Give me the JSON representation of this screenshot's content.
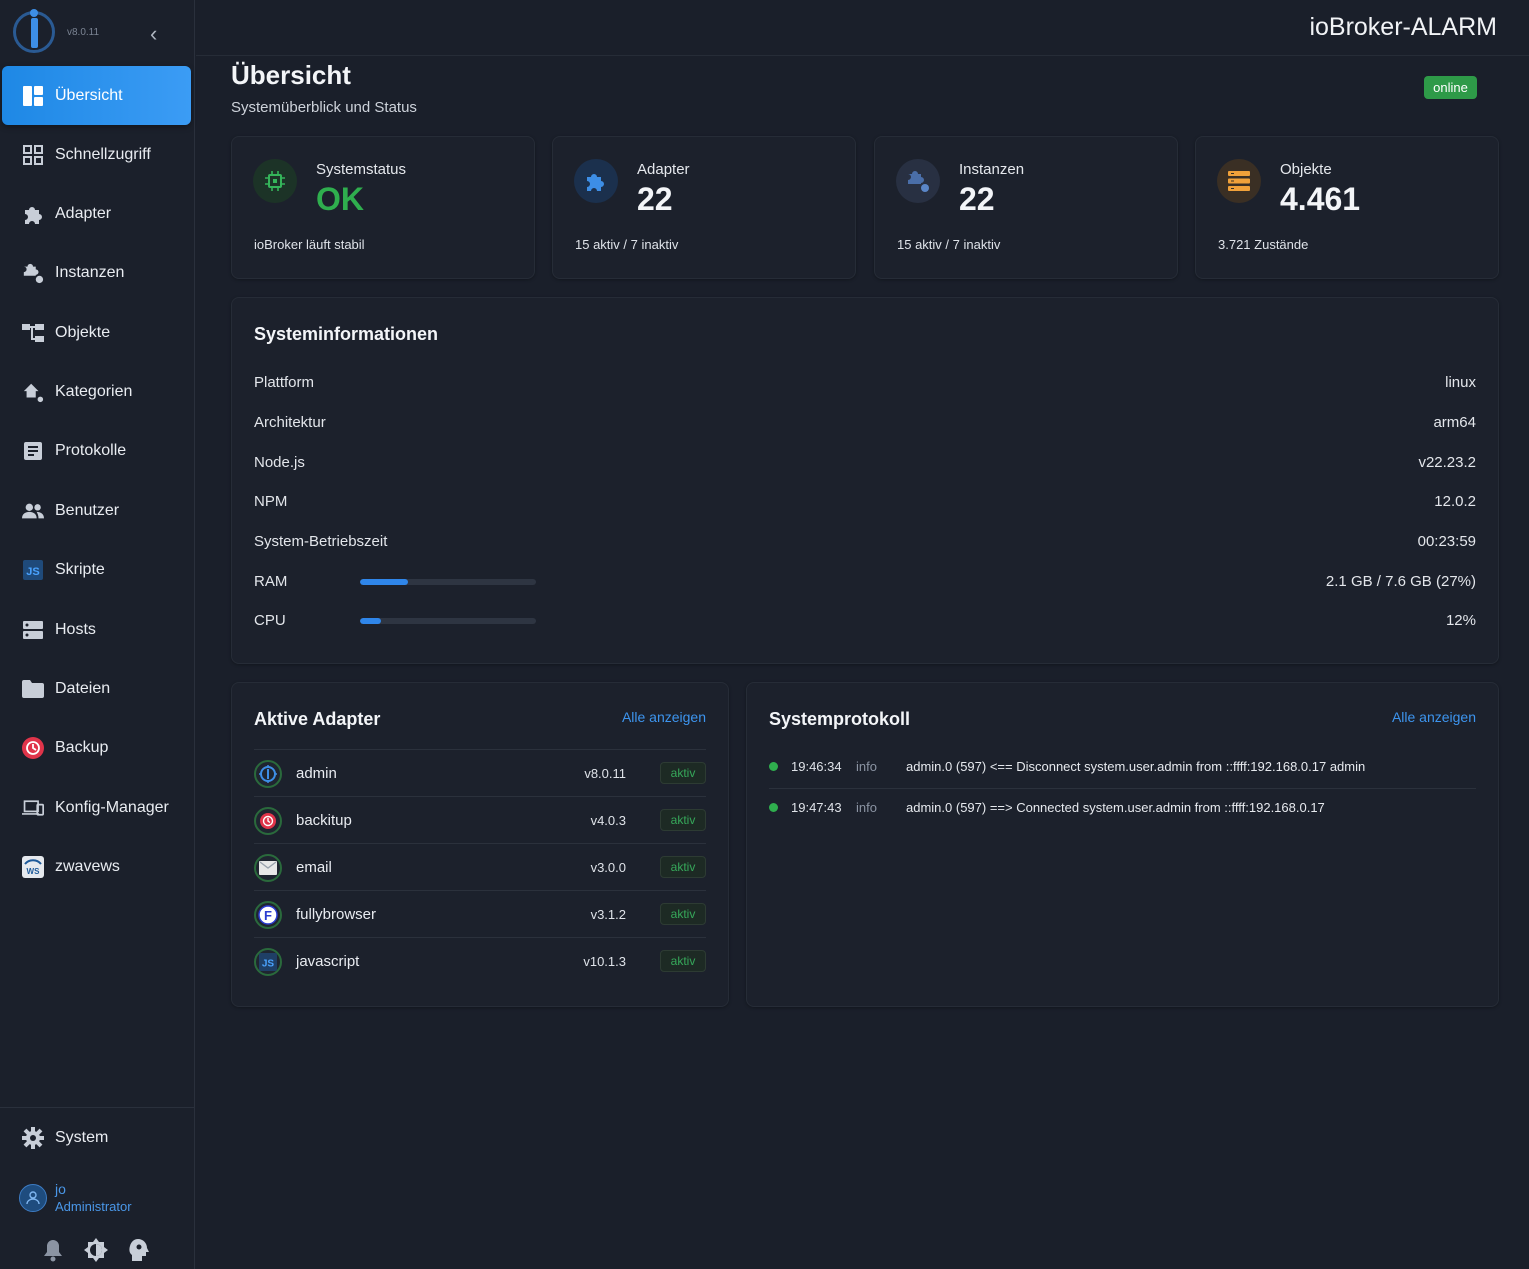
{
  "brand": {
    "version": "v8.0.11"
  },
  "app_title": "ioBroker-ALARM",
  "nav": [
    {
      "label": "Übersicht",
      "icon": "dashboard-icon",
      "active": true
    },
    {
      "label": "Schnellzugriff",
      "icon": "apps-grid-icon"
    },
    {
      "label": "Adapter",
      "icon": "puzzle-icon"
    },
    {
      "label": "Instanzen",
      "icon": "puzzle-dot-icon"
    },
    {
      "label": "Objekte",
      "icon": "tree-icon"
    },
    {
      "label": "Kategorien",
      "icon": "home-dot-icon"
    },
    {
      "label": "Protokolle",
      "icon": "document-list-icon"
    },
    {
      "label": "Benutzer",
      "icon": "users-icon"
    },
    {
      "label": "Skripte",
      "icon": "js-icon"
    },
    {
      "label": "Hosts",
      "icon": "server-icon"
    },
    {
      "label": "Dateien",
      "icon": "folder-icon"
    },
    {
      "label": "Backup",
      "icon": "backup-clock-icon"
    },
    {
      "label": "Konfig-Manager",
      "icon": "devices-icon"
    },
    {
      "label": "zwavews",
      "icon": "zwave-logo-icon"
    }
  ],
  "system_nav": {
    "label": "System"
  },
  "user": {
    "name": "jo",
    "role": "Administrator"
  },
  "page": {
    "title": "Übersicht",
    "subtitle": "Systemüberblick und Status",
    "status_badge": "online"
  },
  "stats": [
    {
      "label": "Systemstatus",
      "value": "OK",
      "sub": "ioBroker läuft stabil"
    },
    {
      "label": "Adapter",
      "value": "22",
      "sub": "15 aktiv / 7 inaktiv"
    },
    {
      "label": "Instanzen",
      "value": "22",
      "sub": "15 aktiv / 7 inaktiv"
    },
    {
      "label": "Objekte",
      "value": "4.461",
      "sub": "3.721 Zustände"
    }
  ],
  "sysinfo": {
    "title": "Systeminformationen",
    "rows": [
      {
        "key": "Plattform",
        "value": "linux"
      },
      {
        "key": "Architektur",
        "value": "arm64"
      },
      {
        "key": "Node.js",
        "value": "v22.23.2"
      },
      {
        "key": "NPM",
        "value": "12.0.2"
      },
      {
        "key": "System-Betriebszeit",
        "value": "00:23:59"
      },
      {
        "key": "RAM",
        "value": "2.1 GB / 7.6 GB (27%)",
        "fraction": 0.27
      },
      {
        "key": "CPU",
        "value": "12%",
        "fraction": 0.12
      }
    ]
  },
  "adapters": {
    "title": "Aktive Adapter",
    "link": "Alle anzeigen",
    "items": [
      {
        "name": "admin",
        "version": "v8.0.11",
        "status": "aktiv",
        "icon": "admin-logo-icon"
      },
      {
        "name": "backitup",
        "version": "v4.0.3",
        "status": "aktiv",
        "icon": "backitup-logo-icon"
      },
      {
        "name": "email",
        "version": "v3.0.0",
        "status": "aktiv",
        "icon": "email-logo-icon"
      },
      {
        "name": "fullybrowser",
        "version": "v3.1.2",
        "status": "aktiv",
        "icon": "fullybrowser-logo-icon"
      },
      {
        "name": "javascript",
        "version": "v10.1.3",
        "status": "aktiv",
        "icon": "js-logo-icon"
      }
    ]
  },
  "syslog": {
    "title": "Systemprotokoll",
    "link": "Alle anzeigen",
    "entries": [
      {
        "time": "19:46:34",
        "level": "info",
        "message": "admin.0 (597) <== Disconnect system.user.admin from ::ffff:192.168.0.17 admin"
      },
      {
        "time": "19:47:43",
        "level": "info",
        "message": "admin.0 (597) ==> Connected system.user.admin from ::ffff:192.168.0.17"
      }
    ]
  },
  "colors": {
    "accent": "#1e88e5",
    "ok": "#2e9a48",
    "background": "#1a1f2a",
    "card": "#1c212c"
  }
}
